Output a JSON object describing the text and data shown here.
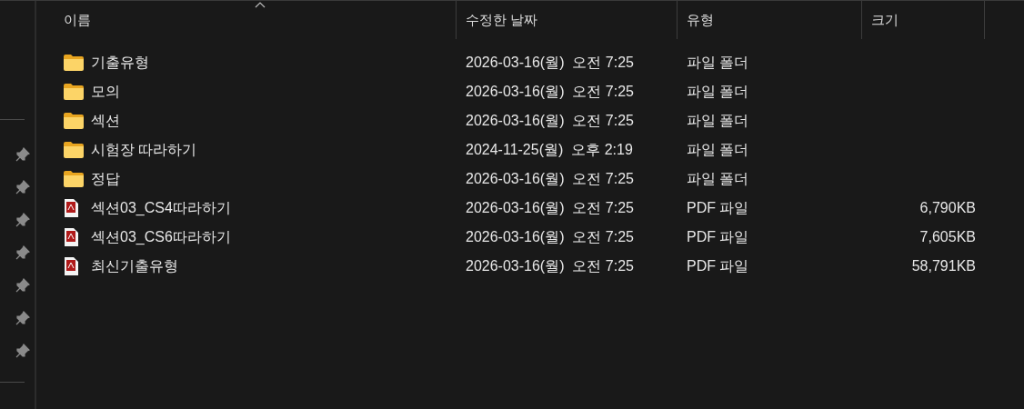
{
  "columns": [
    {
      "label": "이름",
      "sorted": true
    },
    {
      "label": "수정한 날짜",
      "sorted": false
    },
    {
      "label": "유형",
      "sorted": false
    },
    {
      "label": "크기",
      "sorted": false
    }
  ],
  "files": [
    {
      "kind": "folder",
      "name": "기출유형",
      "date": "2026-03-16(월)  오전 7:25",
      "type": "파일 폴더"
    },
    {
      "kind": "folder",
      "name": "모의",
      "date": "2026-03-16(월)  오전 7:25",
      "type": "파일 폴더"
    },
    {
      "kind": "folder",
      "name": "섹션",
      "date": "2026-03-16(월)  오전 7:25",
      "type": "파일 폴더"
    },
    {
      "kind": "folder",
      "name": "시험장 따라하기",
      "date": "2024-11-25(월)  오후 2:19",
      "type": "파일 폴더"
    },
    {
      "kind": "folder",
      "name": "정답",
      "date": "2026-03-16(월)  오전 7:25",
      "type": "파일 폴더"
    },
    {
      "kind": "pdf",
      "name": "섹션03_CS4따라하기",
      "date": "2026-03-16(월)  오전 7:25",
      "type": "PDF 파일",
      "size": "6,790KB"
    },
    {
      "kind": "pdf",
      "name": "섹션03_CS6따라하기",
      "date": "2026-03-16(월)  오전 7:25",
      "type": "PDF 파일",
      "size": "7,605KB"
    },
    {
      "kind": "pdf",
      "name": "최신기출유형",
      "date": "2026-03-16(월)  오전 7:25",
      "type": "PDF 파일",
      "size": "58,791KB"
    }
  ]
}
